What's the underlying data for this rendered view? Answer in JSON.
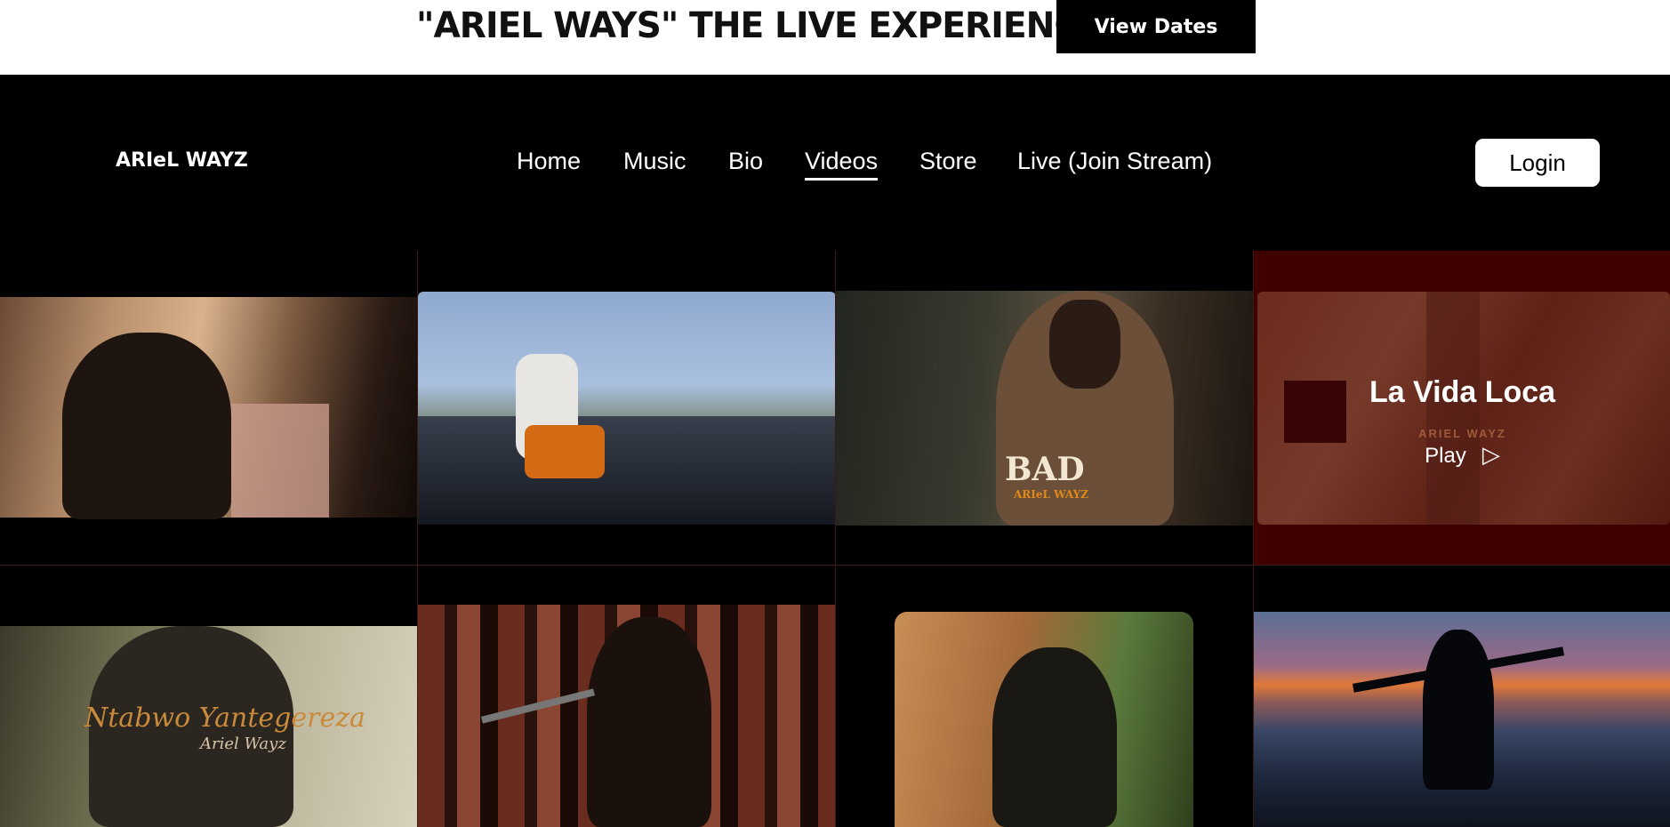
{
  "banner": {
    "title": "\"ARIEL WAYS\" THE LIVE EXPERIENCE",
    "button_label": "View Dates"
  },
  "nav": {
    "logo": "ARIeL WAYZ",
    "items": [
      "Home",
      "Music",
      "Bio",
      "Videos",
      "Store",
      "Live (Join Stream)"
    ],
    "active": "Videos",
    "login_label": "Login"
  },
  "videos": [
    {
      "thumb_text": ""
    },
    {
      "thumb_text": ""
    },
    {
      "thumb_text": "BAD",
      "thumb_sub": "ARIeL WAYZ"
    },
    {
      "thumb_text": "",
      "hover_title": "La Vida Loca",
      "hover_play": "Play",
      "watermark": "ARIEL WAYZ"
    },
    {
      "thumb_text": "Ntabwo Yantegereza",
      "thumb_sub": "Ariel Wayz"
    },
    {
      "thumb_text": ""
    },
    {
      "thumb_text": ""
    },
    {
      "thumb_text": ""
    }
  ],
  "colors": {
    "page_bg": "#000000",
    "banner_bg": "#ffffff",
    "hover_overlay": "#4a0000",
    "text_light": "#ffffff"
  }
}
